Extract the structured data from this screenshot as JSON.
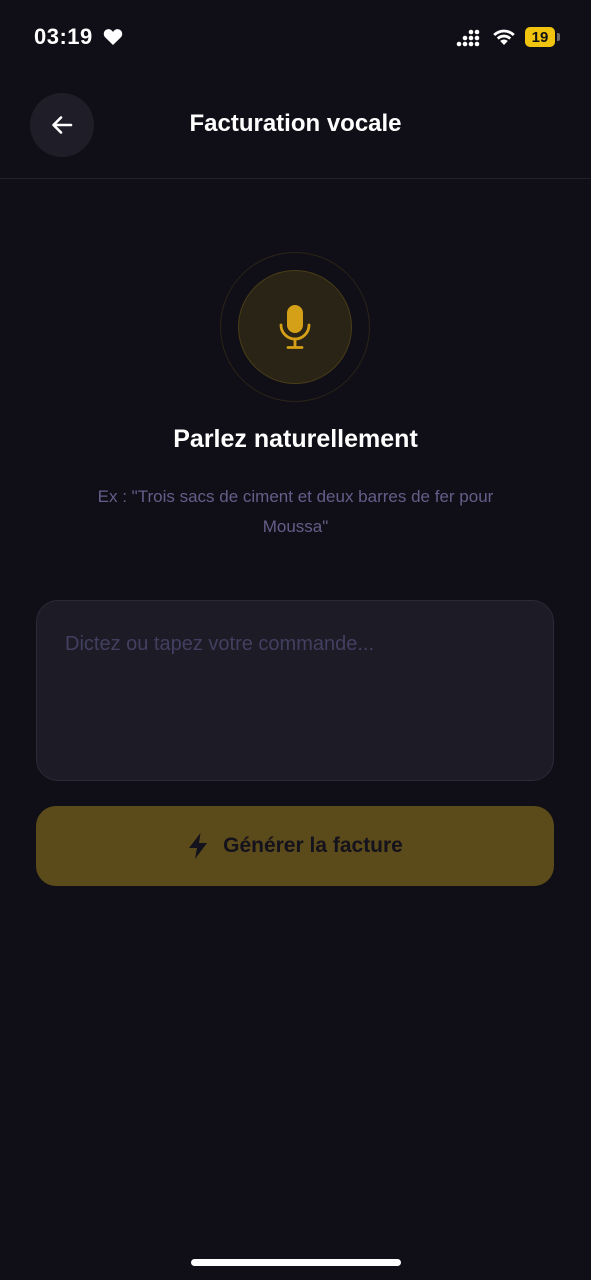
{
  "status_bar": {
    "time": "03:19",
    "battery": "19"
  },
  "header": {
    "title": "Facturation vocale",
    "back_icon": "arrow-left-icon"
  },
  "voice": {
    "mic_icon": "microphone-icon",
    "headline": "Parlez naturellement",
    "hint": "Ex : \"Trois sacs de ciment et deux barres de fer pour Moussa\""
  },
  "command": {
    "value": "",
    "placeholder": "Dictez ou tapez votre commande..."
  },
  "generate": {
    "label": "Générer la facture",
    "icon": "lightning-bolt-icon"
  },
  "colors": {
    "background": "#100f17",
    "accent": "#d4a017",
    "button": "#5b4a1a",
    "hint": "#645e8a"
  }
}
